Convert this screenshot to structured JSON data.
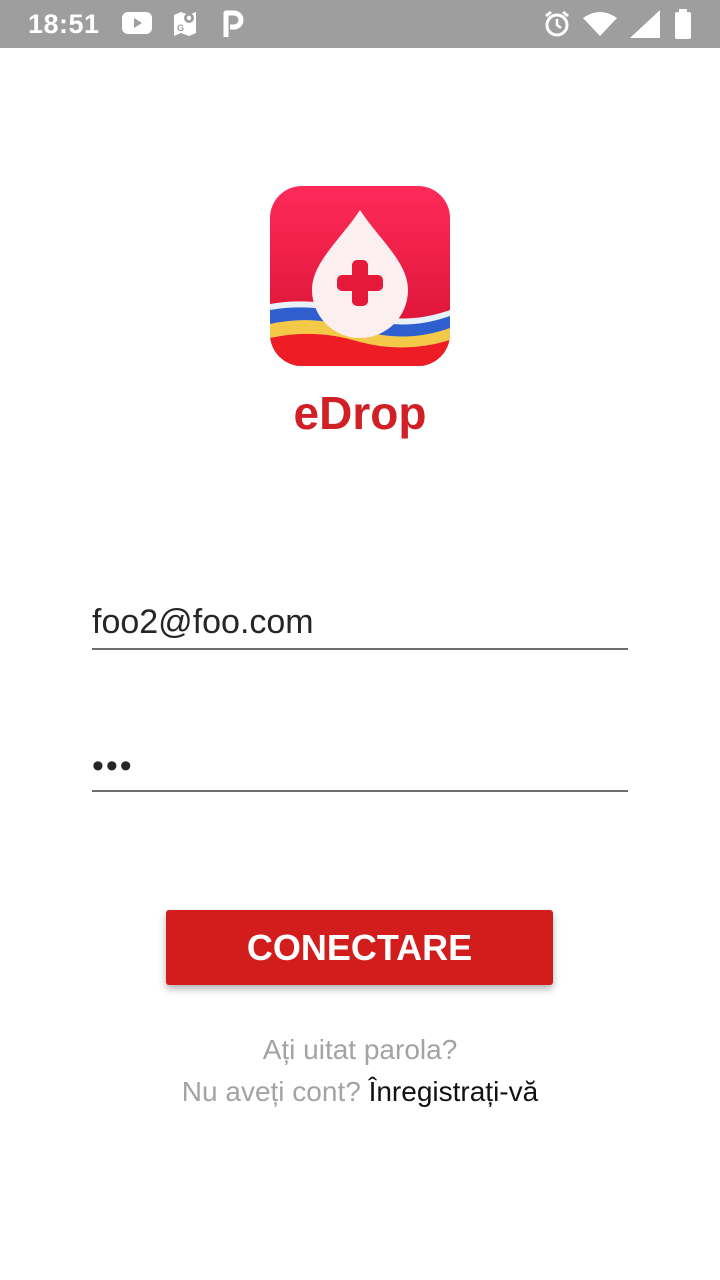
{
  "status_bar": {
    "time": "18:51",
    "left_icons": [
      "youtube-icon",
      "maps-icon",
      "parking-icon"
    ],
    "right_icons": [
      "alarm-icon",
      "wifi-icon",
      "signal-icon",
      "battery-icon"
    ]
  },
  "app": {
    "name": "eDrop",
    "brand_color": "#d11f26"
  },
  "form": {
    "email_value": "foo2@foo.com",
    "password_value": "•••"
  },
  "actions": {
    "login_label": "CONECTARE",
    "forgot_label": "Ați uitat parola?",
    "no_account_label": "Nu aveți cont?",
    "register_label": "Înregistrați-vă"
  }
}
